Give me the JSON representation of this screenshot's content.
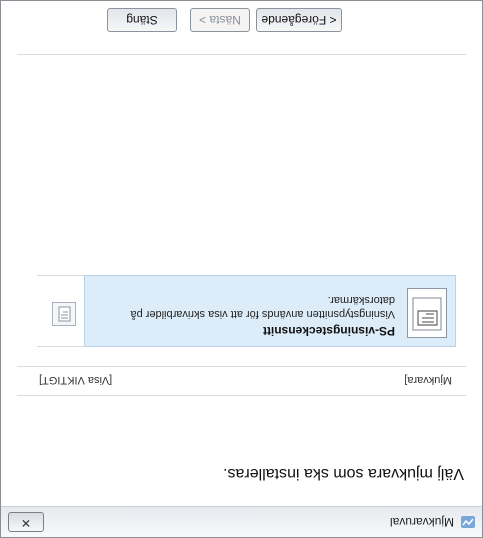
{
  "window": {
    "title": "Mjukvaruval"
  },
  "header": {
    "question": "Välj mjukvara som ska installeras."
  },
  "list": {
    "col_left": "Mjukvara]",
    "col_right": "[Visa VIKTIGT]",
    "items": [
      {
        "title": "PS-visningsteckensnitt",
        "description": "Visningstypsnitten används för att visa skrivarbilder på datorskärmar."
      }
    ]
  },
  "footer": {
    "prev_label": "< Föregående",
    "next_label": "Nästa >",
    "close_label": "Stäng"
  }
}
